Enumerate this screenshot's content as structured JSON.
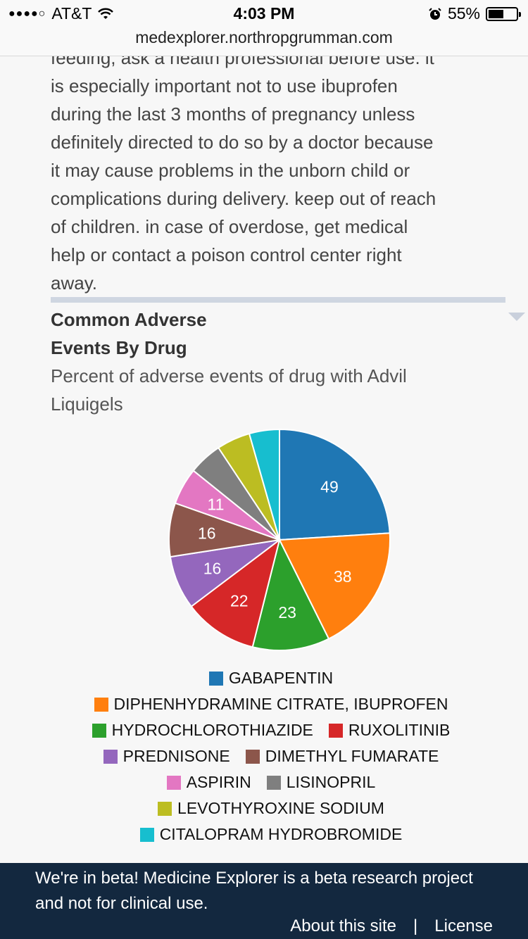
{
  "status_bar": {
    "signal": "●●●●○",
    "carrier": "AT&T",
    "time": "4:03 PM",
    "battery_percent": "55%",
    "battery_level": 0.55
  },
  "browser": {
    "url": "medexplorer.northropgrumman.com"
  },
  "warning_text": {
    "lines": [
      "feeding, ask a health professional before use. it",
      "is especially important not to use ibuprofen",
      "during the last 3 months of pregnancy unless",
      "definitely directed to do so by a doctor because",
      "it may cause problems in the unborn child or",
      "complications during delivery. keep out of reach",
      "of children. in case of overdose, get medical",
      "help or contact a poison control center right",
      "away."
    ]
  },
  "section": {
    "title_line1": "Common Adverse",
    "title_line2": "Events By Drug",
    "subtitle_line1": "Percent of adverse events of drug with Advil",
    "subtitle_line2": "Liquigels"
  },
  "chart_data": {
    "type": "pie",
    "title": "",
    "slices": [
      {
        "label": "GABAPENTIN",
        "value": 49,
        "color": "#1f77b4",
        "show_label": true
      },
      {
        "label": "DIPHENHYDRAMINE CITRATE, IBUPROFEN",
        "value": 38,
        "color": "#ff7f0e",
        "show_label": true
      },
      {
        "label": "HYDROCHLOROTHIAZIDE",
        "value": 23,
        "color": "#2ca02c",
        "show_label": true
      },
      {
        "label": "RUXOLITINIB",
        "value": 22,
        "color": "#d62728",
        "show_label": true
      },
      {
        "label": "PREDNISONE",
        "value": 16,
        "color": "#9467bd",
        "show_label": true
      },
      {
        "label": "DIMETHYL FUMARATE",
        "value": 16,
        "color": "#8c564b",
        "show_label": true
      },
      {
        "label": "ASPIRIN",
        "value": 11,
        "color": "#e377c2",
        "show_label": true
      },
      {
        "label": "LISINOPRIL",
        "value": 10,
        "color": "#7f7f7f",
        "show_label": false
      },
      {
        "label": "LEVOTHYROXINE SODIUM",
        "value": 10,
        "color": "#bcbd22",
        "show_label": false
      },
      {
        "label": "CITALOPRAM HYDROBROMIDE",
        "value": 9,
        "color": "#17becf",
        "show_label": false
      }
    ],
    "legend_position": "bottom",
    "legend_rows": [
      [
        0
      ],
      [
        1
      ],
      [
        2,
        3
      ],
      [
        4,
        5
      ],
      [
        6,
        7
      ],
      [
        8
      ],
      [
        9
      ]
    ]
  },
  "footer": {
    "message": "We're in beta! Medicine Explorer is a beta research project and not for clinical use.",
    "about_label": "About this site",
    "separator": "|",
    "license_label": "License"
  }
}
